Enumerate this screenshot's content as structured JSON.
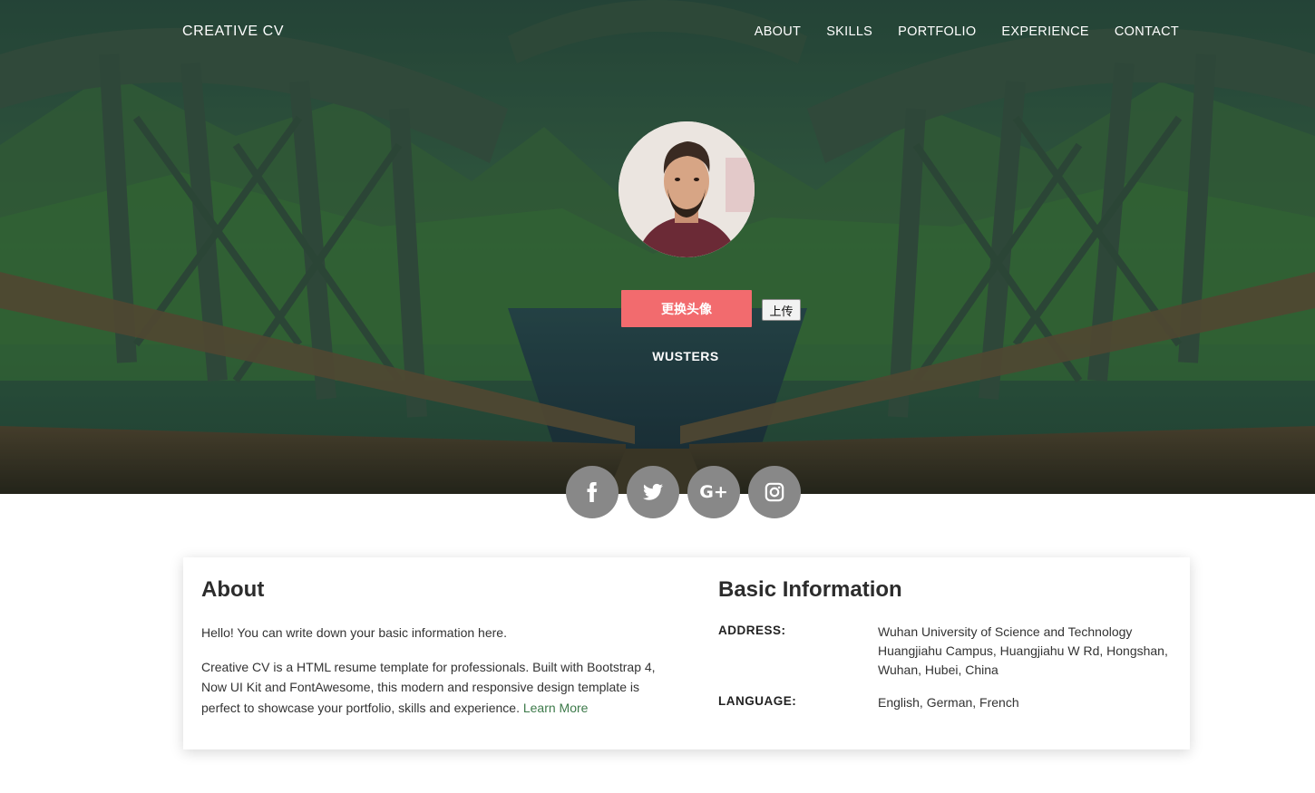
{
  "nav": {
    "brand": "CREATIVE CV",
    "links": [
      "ABOUT",
      "SKILLS",
      "PORTFOLIO",
      "EXPERIENCE",
      "CONTACT"
    ]
  },
  "profile": {
    "change_avatar_label": "更换头像",
    "upload_label": "上传",
    "name": "WUSTERS"
  },
  "social": {
    "icons": [
      "facebook-icon",
      "twitter-icon",
      "google-plus-icon",
      "instagram-icon"
    ],
    "gplus_glyph": "G+"
  },
  "about": {
    "title": "About",
    "para1": "Hello! You can write down your basic information here.",
    "para2": "Creative CV is a HTML resume template for professionals. Built with Bootstrap 4, Now UI Kit and FontAwesome, this modern and responsive design template is perfect to showcase your portfolio, skills and experience.",
    "learn_more": "Learn More"
  },
  "basic_info": {
    "title": "Basic Information",
    "rows": [
      {
        "label": "ADDRESS:",
        "value": "Wuhan University of Science and Technology Huangjiahu Campus, Huangjiahu W Rd, Hongshan, Wuhan, Hubei, China"
      },
      {
        "label": "LANGUAGE:",
        "value": "English, German, French"
      }
    ]
  },
  "colors": {
    "accent_button": "#f26b6e",
    "social_button": "#888888",
    "link": "#3d7a4a"
  }
}
